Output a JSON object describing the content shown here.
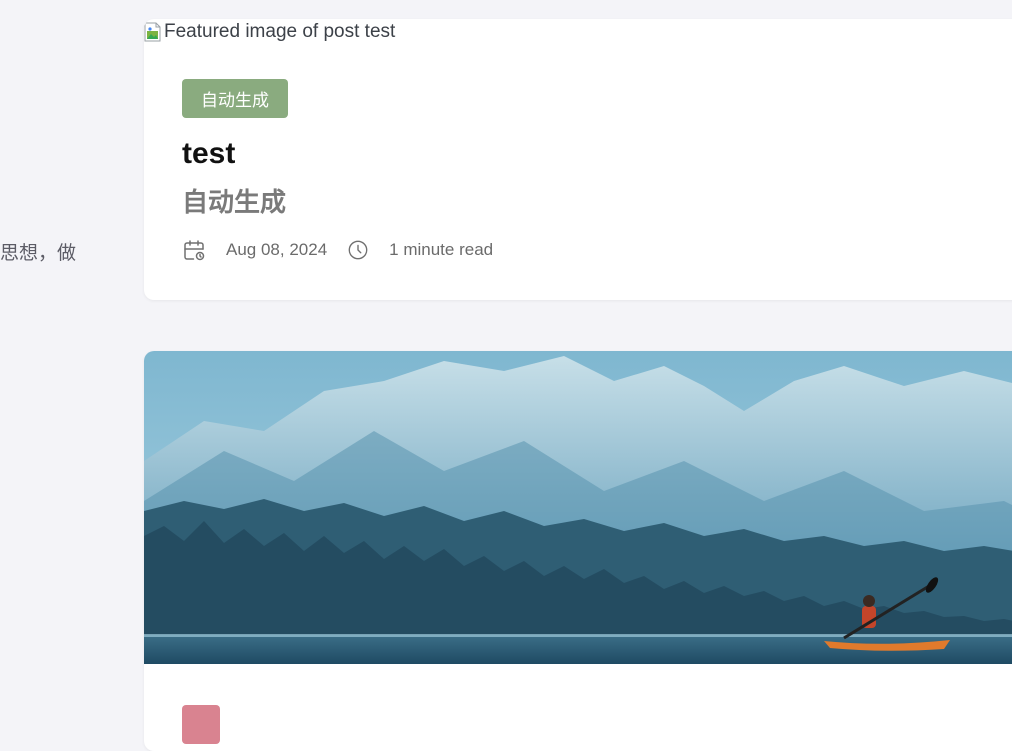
{
  "sidebar": {
    "snippet": "思想，做"
  },
  "posts": [
    {
      "image_alt": "Featured image of post test",
      "category": "自动生成",
      "title": "test",
      "description": "自动生成",
      "date": "Aug 08, 2024",
      "read_time": "1 minute read",
      "tag_color": "#8aab7f"
    },
    {
      "category": "",
      "tag_color": "#d98390",
      "image_description": "mountain-lake-kayak"
    }
  ],
  "icons": {
    "calendar": "calendar-icon",
    "clock": "clock-icon",
    "broken_image": "broken-image-icon"
  }
}
